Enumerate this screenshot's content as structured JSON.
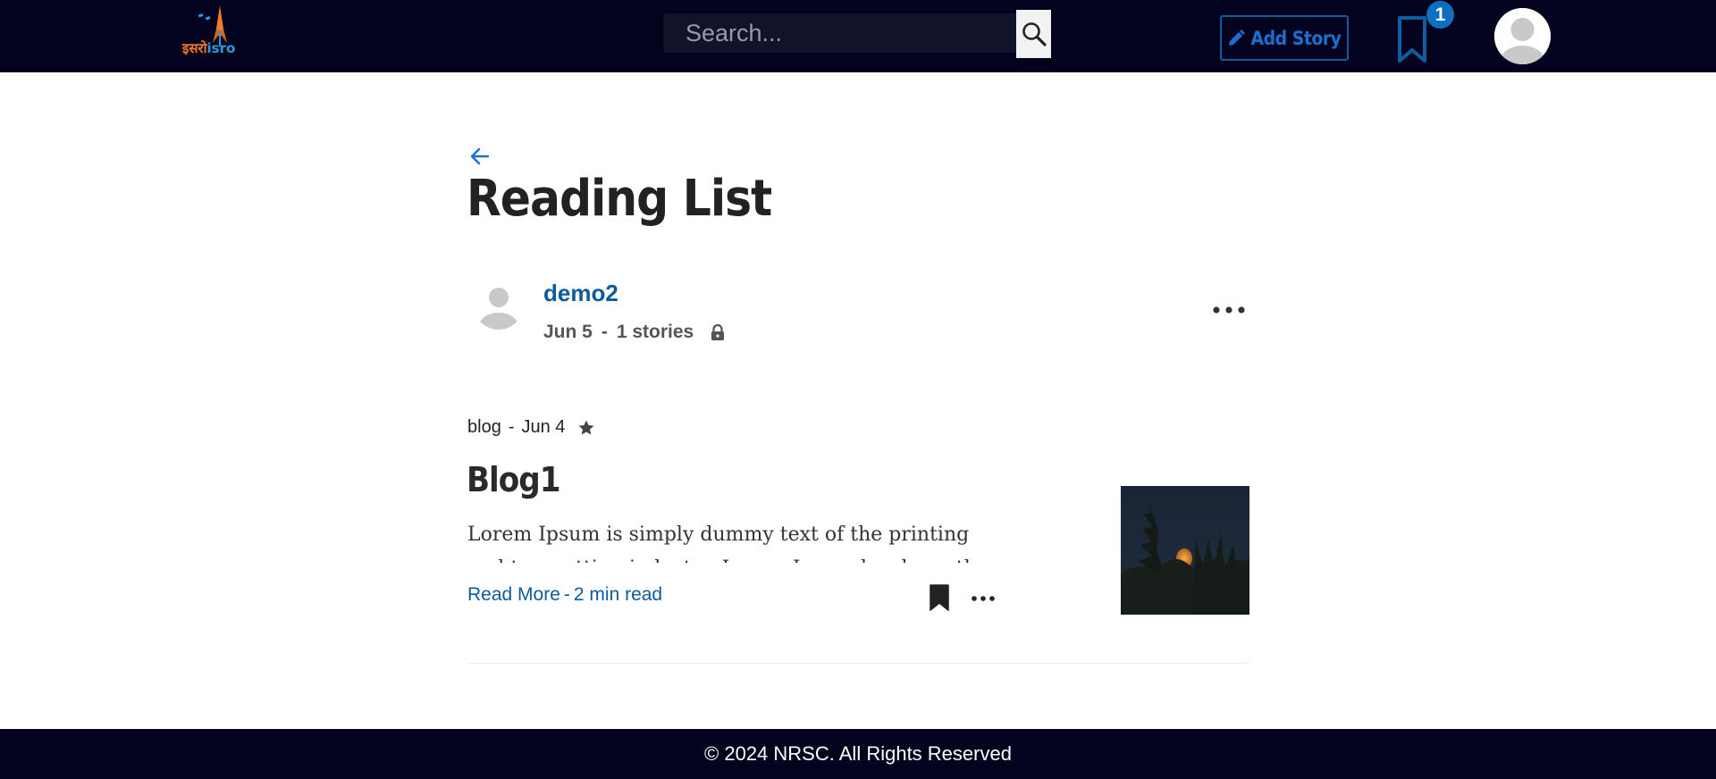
{
  "header": {
    "logo": {
      "hindi": "इसरो",
      "english": "isro"
    },
    "search": {
      "placeholder": "Search...",
      "value": ""
    },
    "add_story_label": "Add Story",
    "bookmarks_count": "1"
  },
  "page": {
    "title": "Reading List"
  },
  "reading_list": {
    "owner": "demo2",
    "date": "Jun 5",
    "separator": "-",
    "stories_count": "1 stories"
  },
  "story": {
    "category": "blog",
    "separator": "-",
    "date": "Jun 4",
    "title": "Blog1",
    "excerpt": "Lorem Ipsum is simply dummy text of the printing and typesetting industry. Lorem Ipsum has been the",
    "read_more_label": "Read More",
    "footer_separator": "-",
    "read_time": "2 min read"
  },
  "footer": {
    "copyright": "© 2024 NRSC. All Rights Reserved"
  },
  "colors": {
    "nav_bg": "#03031e",
    "accent": "#0d5a9c",
    "badge": "#0e6ec0"
  }
}
